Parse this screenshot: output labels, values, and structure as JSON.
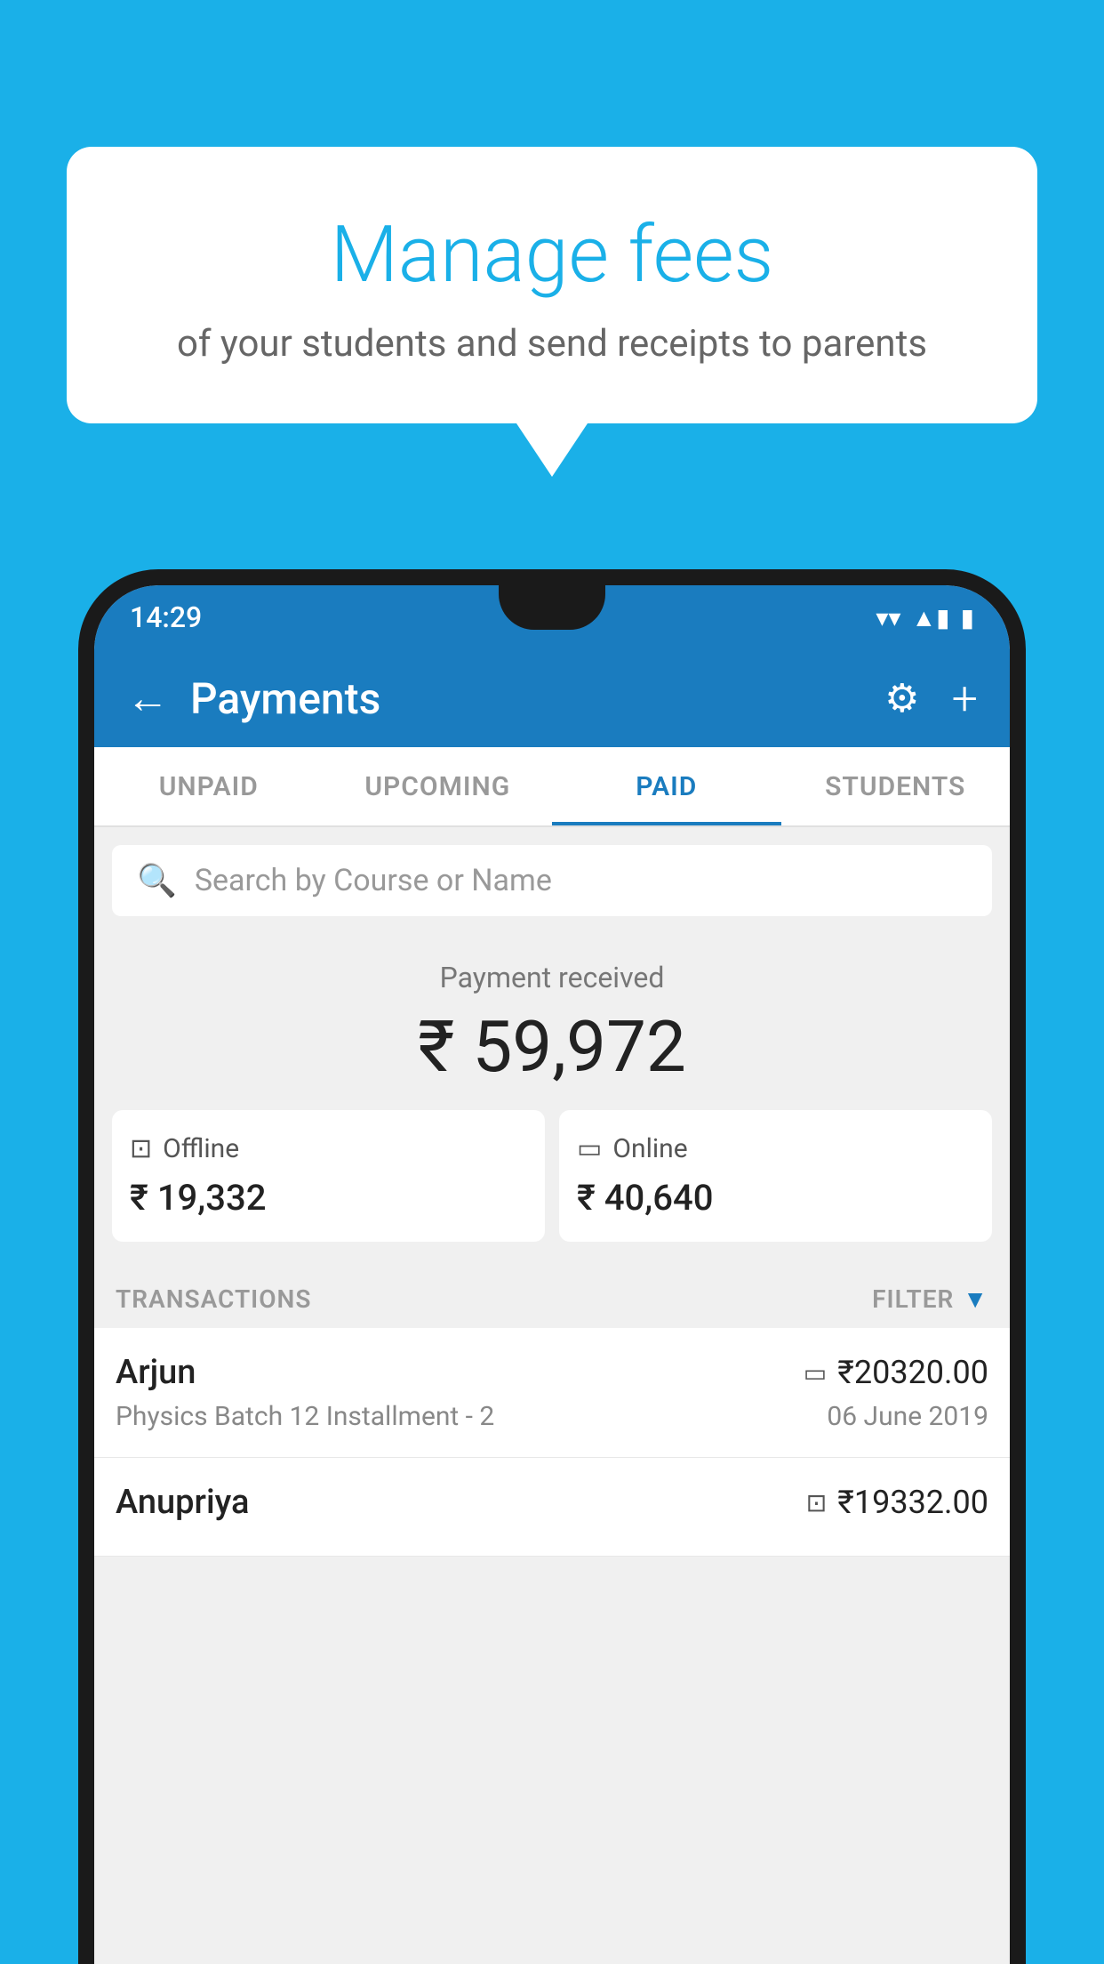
{
  "background": {
    "color": "#1ab0e8"
  },
  "speech_bubble": {
    "title": "Manage fees",
    "subtitle": "of your students and send receipts to parents"
  },
  "status_bar": {
    "time": "14:29",
    "wifi": "▼",
    "signal": "▲",
    "battery": "▮"
  },
  "app_bar": {
    "title": "Payments",
    "back_label": "←",
    "gear_label": "⚙",
    "plus_label": "+"
  },
  "tabs": [
    {
      "label": "UNPAID",
      "active": false
    },
    {
      "label": "UPCOMING",
      "active": false
    },
    {
      "label": "PAID",
      "active": true
    },
    {
      "label": "STUDENTS",
      "active": false
    }
  ],
  "search": {
    "placeholder": "Search by Course or Name"
  },
  "payment_summary": {
    "label": "Payment received",
    "total": "₹ 59,972",
    "offline": {
      "label": "Offline",
      "amount": "₹ 19,332"
    },
    "online": {
      "label": "Online",
      "amount": "₹ 40,640"
    }
  },
  "transactions": {
    "header": "TRANSACTIONS",
    "filter": "FILTER",
    "rows": [
      {
        "name": "Arjun",
        "course": "Physics Batch 12 Installment - 2",
        "amount": "₹20320.00",
        "date": "06 June 2019",
        "pay_type": "card"
      },
      {
        "name": "Anupriya",
        "course": "",
        "amount": "₹19332.00",
        "date": "",
        "pay_type": "cash"
      }
    ]
  }
}
